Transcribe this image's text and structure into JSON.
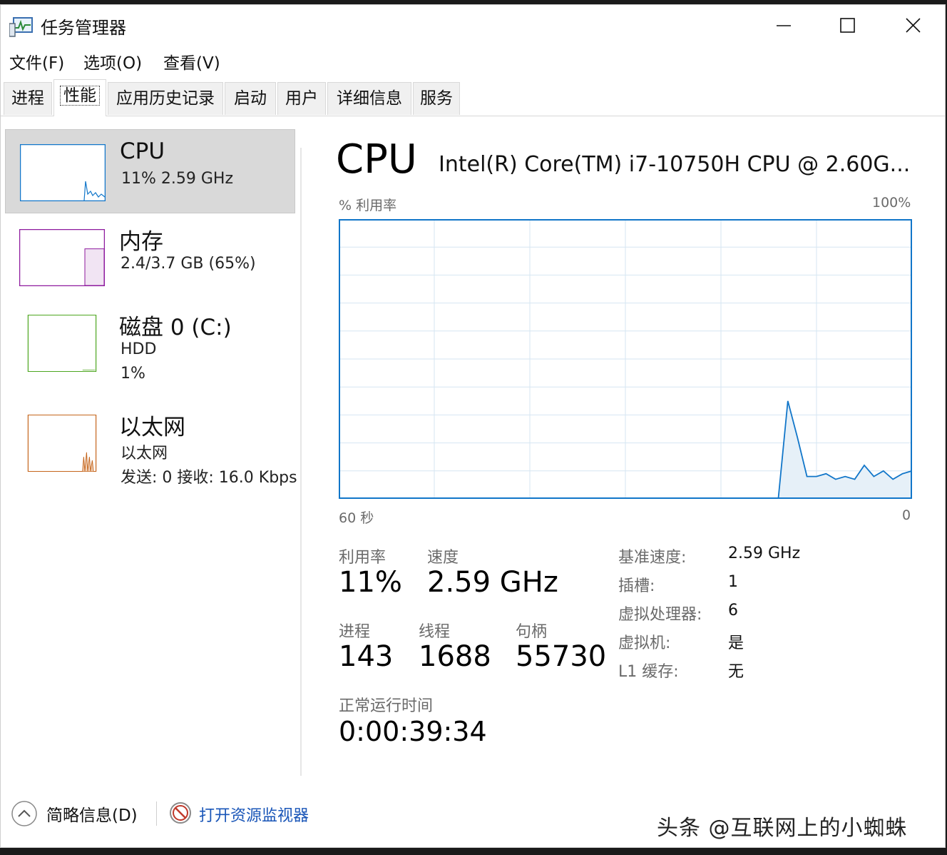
{
  "window": {
    "title": "任务管理器",
    "icon": "task-manager-icon"
  },
  "menu": {
    "file": "文件(F)",
    "options": "选项(O)",
    "view": "查看(V)"
  },
  "tabs": [
    {
      "label": "进程"
    },
    {
      "label": "性能"
    },
    {
      "label": "应用历史记录"
    },
    {
      "label": "启动"
    },
    {
      "label": "用户"
    },
    {
      "label": "详细信息"
    },
    {
      "label": "服务"
    }
  ],
  "resources": {
    "cpu": {
      "title": "CPU",
      "line1": "11%  2.59 GHz",
      "color": "#1176c9"
    },
    "memory": {
      "title": "内存",
      "line1": "2.4/3.7 GB (65%)",
      "color": "#8e1a9e",
      "fill_fraction": 0.65
    },
    "disk": {
      "title": "磁盘 0 (C:)",
      "line1": "HDD",
      "line2": "1%",
      "color": "#4da61f"
    },
    "ethernet": {
      "title": "以太网",
      "line1": "以太网",
      "line2": "发送: 0  接收: 16.0 Kbps",
      "color": "#c5651c"
    }
  },
  "main": {
    "heading": "CPU",
    "model": "Intel(R) Core(TM) i7-10750H CPU @ 2.60G...",
    "util_label": "% 利用率",
    "util_max": "100%",
    "x_start": "60 秒",
    "x_end": "0"
  },
  "chart_data": {
    "type": "area",
    "x": [
      60,
      56,
      54,
      52,
      50,
      48,
      46,
      44,
      42,
      40,
      38,
      36,
      34,
      32,
      30,
      28,
      26,
      24,
      22,
      20,
      18,
      16,
      14,
      13,
      12,
      11,
      10,
      9,
      8,
      7,
      6,
      5,
      4,
      3,
      2,
      1,
      0
    ],
    "values": [
      0,
      0,
      0,
      0,
      0,
      0,
      0,
      0,
      0,
      0,
      0,
      0,
      0,
      0,
      0,
      0,
      0,
      0,
      0,
      0,
      0,
      0,
      0,
      35,
      22,
      8,
      8,
      9,
      7,
      8,
      7,
      12,
      8,
      10,
      7,
      9,
      10
    ],
    "ylim": [
      0,
      100
    ],
    "xlim": [
      60,
      0
    ],
    "grid": true,
    "color": "#1176c9"
  },
  "stats": {
    "utilization_label": "利用率",
    "utilization": "11%",
    "speed_label": "速度",
    "speed": "2.59 GHz",
    "processes_label": "进程",
    "processes": "143",
    "threads_label": "线程",
    "threads": "1688",
    "handles_label": "句柄",
    "handles": "55730",
    "uptime_label": "正常运行时间",
    "uptime": "0:00:39:34"
  },
  "details": [
    {
      "key": "基准速度:",
      "value": "2.59 GHz"
    },
    {
      "key": "插槽:",
      "value": "1"
    },
    {
      "key": "虚拟处理器:",
      "value": "6"
    },
    {
      "key": "虚拟机:",
      "value": "是"
    },
    {
      "key": "L1 缓存:",
      "value": "无"
    }
  ],
  "footer": {
    "brief": "简略信息(D)",
    "resource_monitor": "打开资源监视器"
  },
  "watermark": "头条 @互联网上的小蜘蛛"
}
